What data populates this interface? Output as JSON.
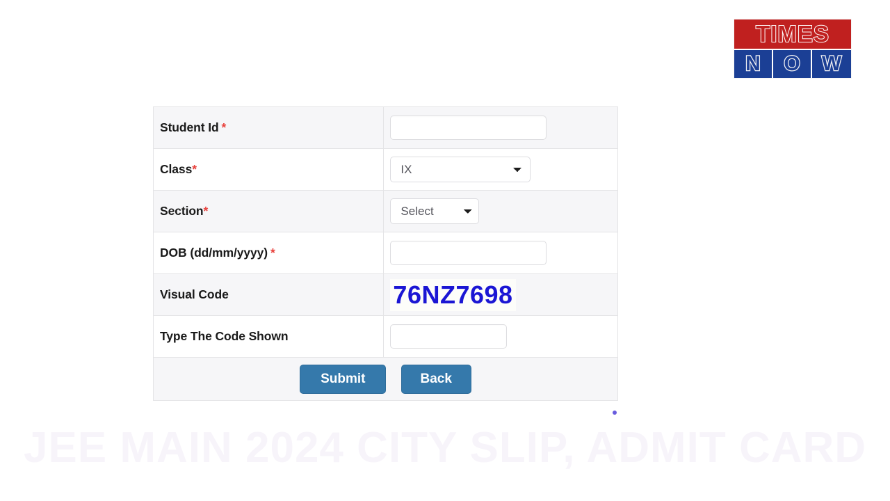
{
  "logo": {
    "name": "times-now-logo",
    "top_text": "TIMES",
    "bottom_letters": [
      "N",
      "O",
      "W"
    ],
    "red": "#c0201f",
    "blue": "#1b3f95"
  },
  "form": {
    "rows": [
      {
        "label": "Student Id",
        "required": true,
        "required_mark": "*",
        "field_type": "text",
        "value": "",
        "placeholder": ""
      },
      {
        "label": "Class",
        "required": true,
        "required_mark": "*",
        "field_type": "select",
        "value": "IX",
        "options": [
          "IX"
        ]
      },
      {
        "label": "Section",
        "required": true,
        "required_mark": "*",
        "field_type": "select",
        "value": "Select",
        "options": [
          "Select"
        ]
      },
      {
        "label": "DOB (dd/mm/yyyy)",
        "required": true,
        "required_mark": "*",
        "field_type": "text",
        "value": "",
        "placeholder": ""
      },
      {
        "label": "Visual Code",
        "required": false,
        "required_mark": "",
        "field_type": "captcha",
        "value": "76NZ7698"
      },
      {
        "label": "Type The Code Shown",
        "required": false,
        "required_mark": "",
        "field_type": "text-narrow",
        "value": "",
        "placeholder": ""
      }
    ],
    "buttons": {
      "submit_label": "Submit",
      "back_label": "Back",
      "accent_color": "#3579ab"
    },
    "captcha_color": "#1b16d4"
  },
  "watermark": {
    "text": "JEE MAIN 2024 CITY SLIP, ADMIT CARD"
  }
}
